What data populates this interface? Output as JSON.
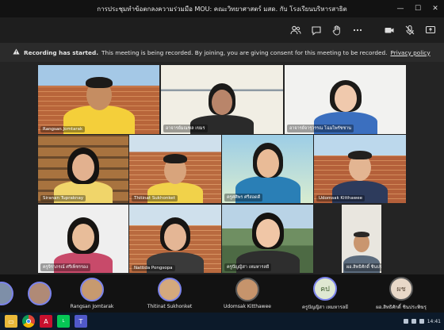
{
  "window": {
    "title": "การประชุมทำข้อตกลงความร่วมมือ MOU: คณะวิทยาศาสตร์ มสด. กับ โรงเรียนบริหารสาธิต",
    "controls": [
      "minimize-icon",
      "maximize-icon",
      "close-icon"
    ]
  },
  "toolbar": {
    "buttons": [
      "people-icon",
      "chat-icon",
      "raise-hand-icon",
      "more-icon",
      "camera-icon",
      "mic-icon",
      "share-icon"
    ]
  },
  "banner": {
    "title": "Recording has started.",
    "message": "This meeting is being recorded. By joining, you are giving consent for this meeting to be recorded.",
    "link": "Privacy policy"
  },
  "tiles": [
    {
      "name": "Rangsan Jomtarak"
    },
    {
      "name": "อาจารย์มณฑล เขมร"
    },
    {
      "name": "อาจารย์จารุวรรณ โฉมไพรัชชาน"
    },
    {
      "name": "Siranan Tupraknay"
    },
    {
      "name": "Thitinat Sukhonket"
    },
    {
      "name": "ครูศศิพร ศรีสอดดี"
    },
    {
      "name": "Udomsak Kitthawee"
    },
    {
      "name": "ครูจิราภรณ์ ศรีเพ็ชรรอง"
    },
    {
      "name": "Nattida Pongsopa"
    },
    {
      "name": "ครูปัญญิสา เหมหารลยี"
    },
    {
      "name": "ผอ.สิทธิศักดิ์ ชินประพิฆรุ"
    }
  ],
  "strip": [
    {
      "name": "Rangsan Jomtarak"
    },
    {
      "name": "Thitinat Sukhonket"
    },
    {
      "name": "Udomsak Kitthawee"
    },
    {
      "name": "ครูปัญญิสา เหมหารลยี",
      "initials": "คป"
    },
    {
      "name": "ผอ.สิทธิศักดิ์ ชินประพิฆรุ",
      "initials": "ผช"
    }
  ],
  "taskbar": {
    "apps": [
      "file-explorer-icon",
      "chrome-icon",
      "acrobat-icon",
      "line-icon",
      "teams-icon"
    ],
    "clock": "14:41"
  },
  "colors": {
    "title_bar": "#121212",
    "toolbar": "#1e1e1e",
    "banner": "#2b2b2b",
    "accent": "#7b83eb",
    "taskbar": "#0c1a2a"
  }
}
